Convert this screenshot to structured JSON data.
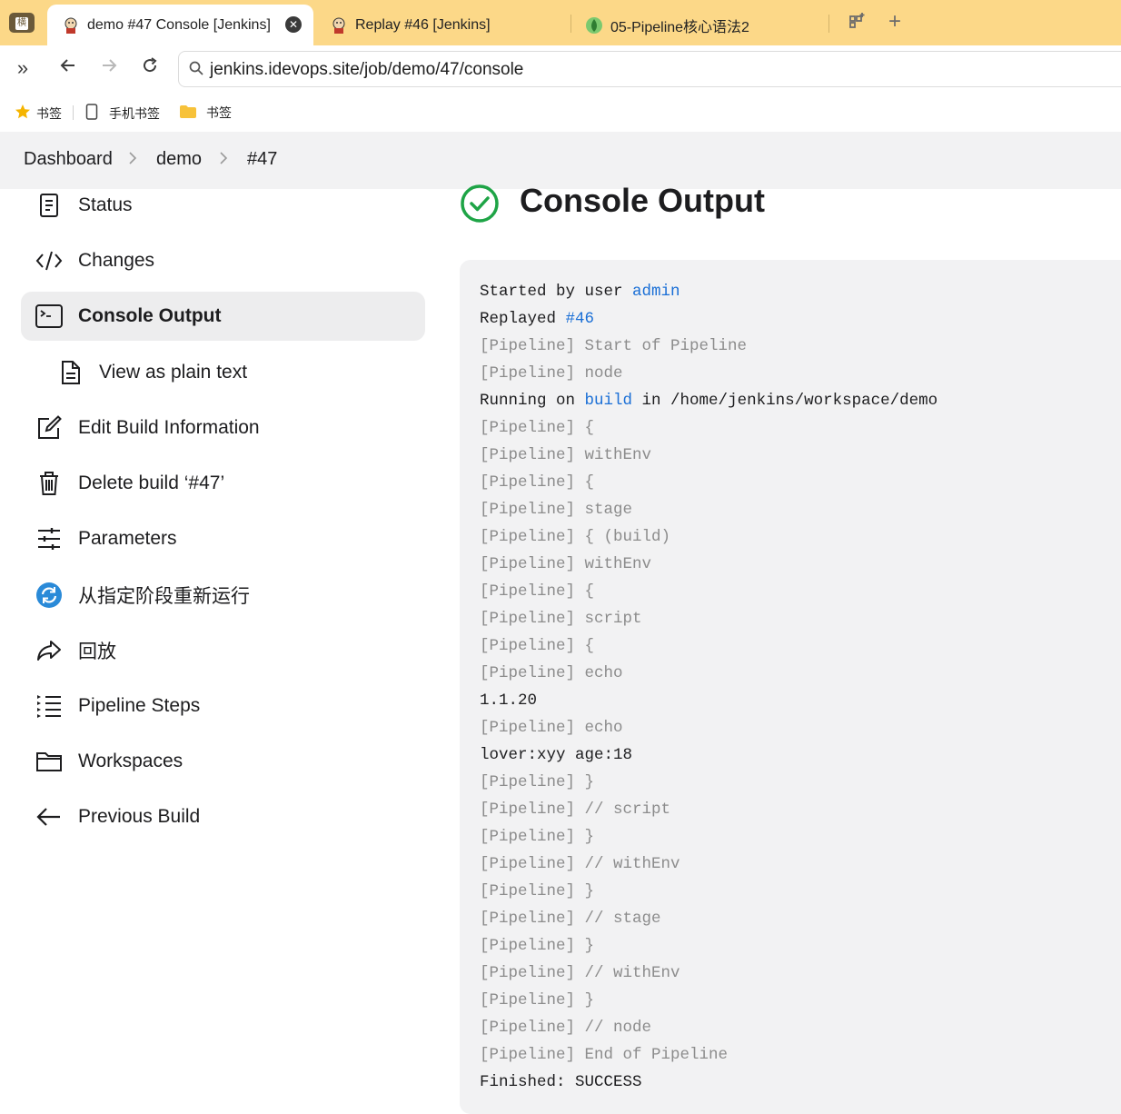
{
  "browser": {
    "tabs": [
      {
        "title": "demo #47 Console [Jenkins]",
        "active": true
      },
      {
        "title": "Replay #46 [Jenkins]",
        "active": false
      },
      {
        "title": "05-Pipeline核心语法2",
        "active": false
      }
    ],
    "sidebar_toggle_label": "横",
    "url": "jenkins.idevops.site/job/demo/47/console",
    "bookmarks": [
      {
        "label": "书签",
        "icon": "star-icon"
      },
      {
        "label": "手机书签",
        "icon": "phone-icon"
      },
      {
        "label": "书签",
        "icon": "folder-icon"
      }
    ]
  },
  "breadcrumb": [
    "Dashboard",
    "demo",
    "#47"
  ],
  "sidebar": {
    "items": [
      {
        "label": "Status",
        "icon": "status-icon"
      },
      {
        "label": "Changes",
        "icon": "code-icon"
      },
      {
        "label": "Console Output",
        "icon": "terminal-icon",
        "active": true
      },
      {
        "label": "View as plain text",
        "icon": "document-icon",
        "sub": true
      },
      {
        "label": "Edit Build Information",
        "icon": "edit-icon"
      },
      {
        "label": "Delete build ‘#47’",
        "icon": "trash-icon"
      },
      {
        "label": "Parameters",
        "icon": "sliders-icon"
      },
      {
        "label": "从指定阶段重新运行",
        "icon": "restart-icon"
      },
      {
        "label": "回放",
        "icon": "replay-icon"
      },
      {
        "label": "Pipeline Steps",
        "icon": "list-icon"
      },
      {
        "label": "Workspaces",
        "icon": "folder-icon"
      },
      {
        "label": "Previous Build",
        "icon": "arrow-left-icon"
      }
    ]
  },
  "main": {
    "title": "Console Output",
    "status": "success",
    "colors": {
      "success": "#1ea446",
      "link": "#1a6fd6",
      "dim": "#8c8c8c"
    }
  },
  "console": {
    "lines": [
      {
        "text": "Started by user ",
        "link": "admin",
        "after": ""
      },
      {
        "text": "Replayed ",
        "link": "#46",
        "after": ""
      },
      {
        "text": "[Pipeline] Start of Pipeline",
        "dim": true
      },
      {
        "text": "[Pipeline] node",
        "dim": true
      },
      {
        "text": "Running on ",
        "link": "build",
        "after": " in /home/jenkins/workspace/demo"
      },
      {
        "text": "[Pipeline] {",
        "dim": true
      },
      {
        "text": "[Pipeline] withEnv",
        "dim": true
      },
      {
        "text": "[Pipeline] {",
        "dim": true
      },
      {
        "text": "[Pipeline] stage",
        "dim": true
      },
      {
        "text": "[Pipeline] { (build)",
        "dim": true
      },
      {
        "text": "[Pipeline] withEnv",
        "dim": true
      },
      {
        "text": "[Pipeline] {",
        "dim": true
      },
      {
        "text": "[Pipeline] script",
        "dim": true
      },
      {
        "text": "[Pipeline] {",
        "dim": true
      },
      {
        "text": "[Pipeline] echo",
        "dim": true
      },
      {
        "text": "1.1.20"
      },
      {
        "text": "[Pipeline] echo",
        "dim": true
      },
      {
        "text": "lover:xyy age:18"
      },
      {
        "text": "[Pipeline] }",
        "dim": true
      },
      {
        "text": "[Pipeline] // script",
        "dim": true
      },
      {
        "text": "[Pipeline] }",
        "dim": true
      },
      {
        "text": "[Pipeline] // withEnv",
        "dim": true
      },
      {
        "text": "[Pipeline] }",
        "dim": true
      },
      {
        "text": "[Pipeline] // stage",
        "dim": true
      },
      {
        "text": "[Pipeline] }",
        "dim": true
      },
      {
        "text": "[Pipeline] // withEnv",
        "dim": true
      },
      {
        "text": "[Pipeline] }",
        "dim": true
      },
      {
        "text": "[Pipeline] // node",
        "dim": true
      },
      {
        "text": "[Pipeline] End of Pipeline",
        "dim": true
      },
      {
        "text": "Finished: SUCCESS"
      }
    ]
  }
}
